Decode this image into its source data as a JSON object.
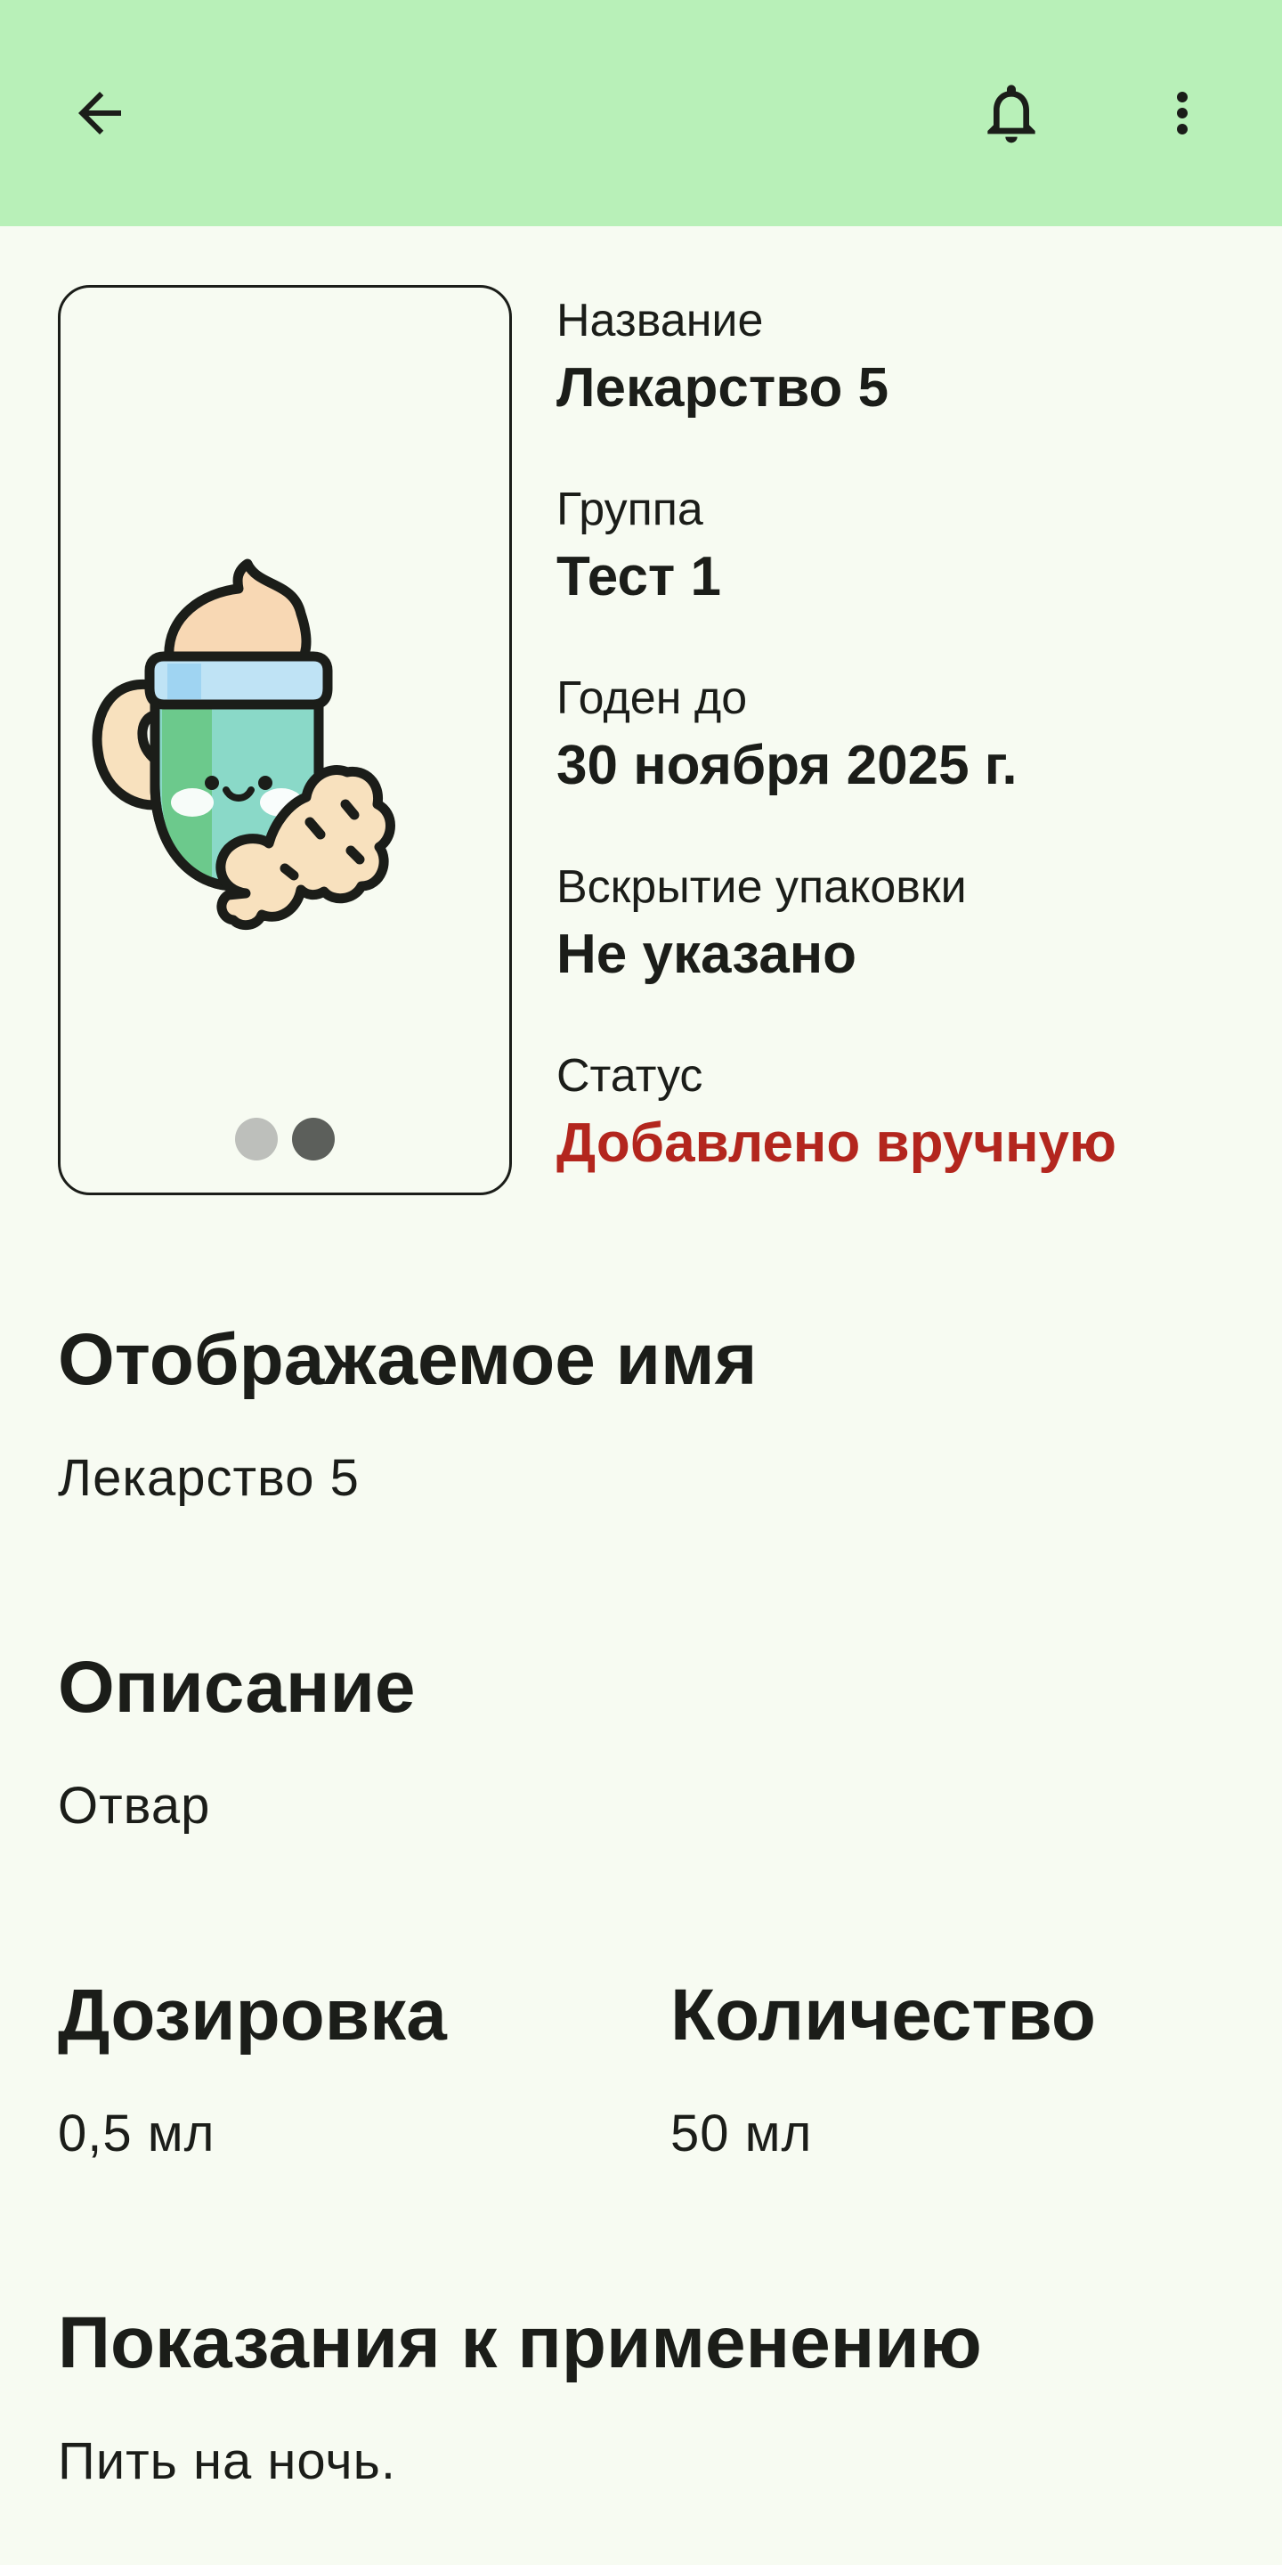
{
  "colors": {
    "appbar": "#B8F0B8",
    "background": "#F7FBF2",
    "text": "#1B1D19",
    "status": "#B3261E",
    "dot_inactive": "#BDBFBB",
    "dot_active": "#5C5F5B"
  },
  "appbar": {
    "back_icon": "arrow-back-icon",
    "notification_icon": "bell-icon",
    "more_icon": "more-vert-icon"
  },
  "gallery": {
    "image": "tea-cup-ginger-illustration",
    "pages": 2,
    "current_page": 2
  },
  "info": [
    {
      "label": "Название",
      "value": "Лекарство 5"
    },
    {
      "label": "Группа",
      "value": "Тест 1"
    },
    {
      "label": "Годен до",
      "value": "30 ноября 2025 г."
    },
    {
      "label": "Вскрытие упаковки",
      "value": "Не указано"
    },
    {
      "label": "Статус",
      "value": "Добавлено вручную"
    }
  ],
  "sections": {
    "display_name": {
      "title": "Отображаемое имя",
      "text": "Лекарство 5"
    },
    "description": {
      "title": "Описание",
      "text": "Отвар"
    },
    "dosage": {
      "title": "Дозировка",
      "text": "0,5 мл"
    },
    "quantity": {
      "title": "Количество",
      "text": "50 мл"
    },
    "indications": {
      "title": "Показания к применению",
      "text": "Пить на ночь."
    }
  }
}
